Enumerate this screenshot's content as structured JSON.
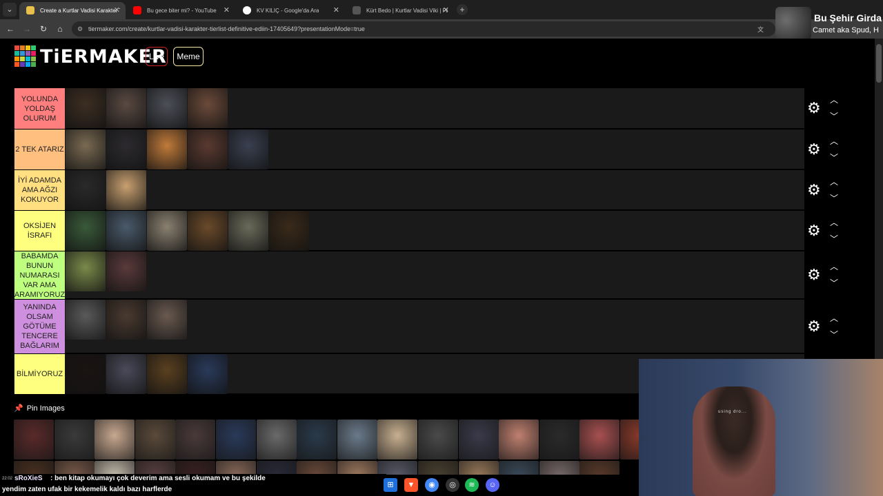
{
  "browser": {
    "tabs": [
      {
        "label": "Create a Kurtlar Vadisi Karakter Tierlist",
        "active": true,
        "favicon_color": "#e8c14a"
      },
      {
        "label": "Bu gece biter mi? - YouTube",
        "active": false,
        "favicon_color": "#ff0000"
      },
      {
        "label": "KV KILIÇ - Google'da Ara",
        "active": false,
        "favicon_color": "#ffffff"
      },
      {
        "label": "Kürt Bedo | Kurtlar Vadisi Viki | Fandom",
        "active": false,
        "favicon_color": "#555555"
      }
    ],
    "url": "tiermaker.com/create/kurtlar-vadisi-karakter-tierlist-definitive-ediin-17405649?presentationMode=true"
  },
  "stream_overlay": {
    "title": "Bu Şehir Girda",
    "subtitle": "Camet aka Spud, H"
  },
  "header": {
    "logo_text": "TiERMAKER",
    "live_label": "Live",
    "meme_label": "Meme",
    "logo_colors": [
      "#e74c3c",
      "#e67e22",
      "#f1c40f",
      "#2ecc71",
      "#1abc9c",
      "#3498db",
      "#9b59b6",
      "#e91e63",
      "#ff9800",
      "#cddc39",
      "#00bcd4",
      "#8bc34a",
      "#ff5722",
      "#673ab7",
      "#03a9f4",
      "#4caf50"
    ]
  },
  "tiers": [
    {
      "label": "YOLUNDA YOLDAŞ OLURUM",
      "color": "#ff7f7f",
      "items": [
        "#3d2e22",
        "#5a4a42",
        "#4d4f57",
        "#6b4a3a"
      ]
    },
    {
      "label": "2 TEK ATARIZ",
      "color": "#ffbf7f",
      "items": [
        "#7a6a52",
        "#2c2a2e",
        "#c07a3a",
        "#5a3a30",
        "#3a4050"
      ]
    },
    {
      "label": "İYİ ADAMDA AMA AĞZI KOKUYOR",
      "color": "#ffdf7f",
      "items": [
        "#2a2a2a",
        "#c8a070"
      ]
    },
    {
      "label": "OKSİJEN İSRAFI",
      "color": "#ffff7f",
      "items": [
        "#3a5a3a",
        "#4a5a6a",
        "#8a8070",
        "#6a4a2a",
        "#6a6a5a",
        "#3a2a1a"
      ]
    },
    {
      "label": "BABAMDA BUNUN NUMARASI VAR AMA ARAMIYORUZ",
      "color": "#bfff7f",
      "items": [
        "#7a8a4a",
        "#5a3a3a"
      ]
    },
    {
      "label": "YANINDA OLSAM GÖTÜME TENCERE BAĞLARIM",
      "color": "#cf8fdf",
      "items": [
        "#5a5a5a",
        "#4a3a30",
        "#6a5a50"
      ]
    },
    {
      "label": "BİLMİYORUZ",
      "color": "#ffff7f",
      "items": [
        "#1a1412",
        "#4a4a5a",
        "#5a4020",
        "#2a3a5a"
      ]
    }
  ],
  "pin_label": "Pin Images",
  "pool_colors": [
    "#5a2a2a",
    "#3a3a3a",
    "#c8a890",
    "#5a4a3a",
    "#4a3a3a",
    "#2a3a5a",
    "#6a6a6a",
    "#2a3a4a",
    "#6a7a8a",
    "#c8b090",
    "#4a4a4a",
    "#3a3a4a",
    "#c08070",
    "#2a2a2a",
    "#a85050",
    "#8a3a2a",
    "#4a3020",
    "#7a5a4a",
    "#c8c0b0",
    "#5a4040",
    "#3a2020",
    "#8a6a5a",
    "#2a2a3a",
    "#6a4a3a",
    "#a07a60",
    "#5a5a6a",
    "#4a4030",
    "#9a7a5a",
    "#3a4a5a",
    "#7a6a6a",
    "#5a3a2a"
  ],
  "chat": {
    "time": "22:02",
    "user": "sRoXieS",
    "line1": ": ben kitap okumayı çok deverim ama sesli okumam ve bu şekilde",
    "line2": "yendim zaten ufak bir kekemelik kaldı bazı harflerde"
  },
  "webcam_text": "using dro..."
}
